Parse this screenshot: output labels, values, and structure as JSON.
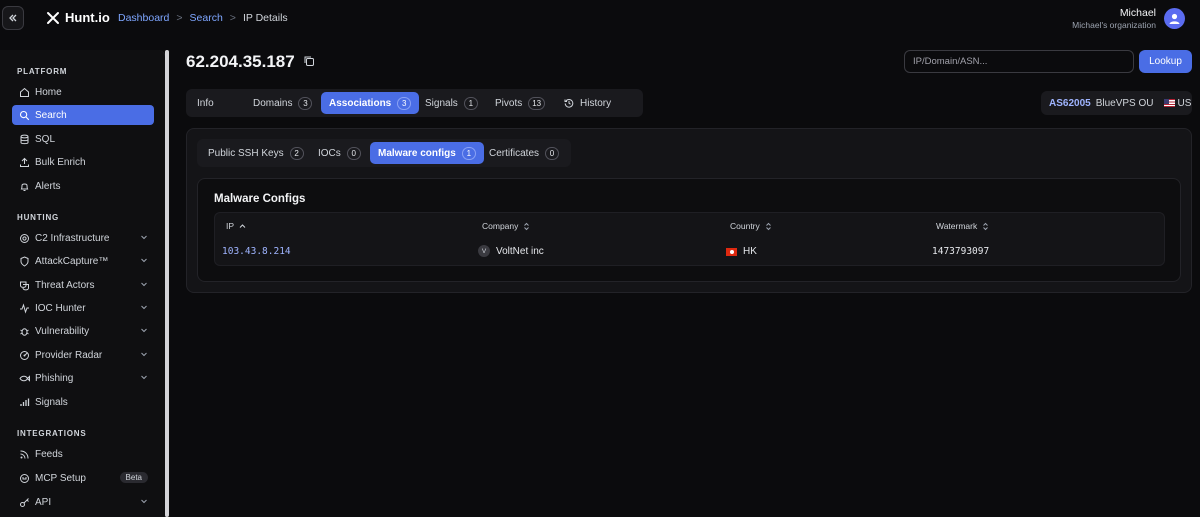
{
  "app": {
    "logo": "Hunt.io"
  },
  "breadcrumb": [
    "Dashboard",
    "Search",
    "IP Details"
  ],
  "breadcrumb_sep": ">",
  "user": {
    "name": "Michael",
    "org": "Michael's organization"
  },
  "sidebar": {
    "platform_title": "PLATFORM",
    "platform": [
      {
        "label": "Home",
        "icon": "home-icon"
      },
      {
        "label": "Search",
        "icon": "search-icon",
        "active": true
      },
      {
        "label": "SQL",
        "icon": "database-icon"
      },
      {
        "label": "Bulk Enrich",
        "icon": "upload-icon"
      },
      {
        "label": "Alerts",
        "icon": "bell-icon"
      }
    ],
    "hunting_title": "HUNTING",
    "hunting": [
      {
        "label": "C2 Infrastructure",
        "icon": "target-icon"
      },
      {
        "label": "AttackCapture™",
        "icon": "shield-icon"
      },
      {
        "label": "Threat Actors",
        "icon": "masks-icon"
      },
      {
        "label": "IOC Hunter",
        "icon": "activity-icon"
      },
      {
        "label": "Vulnerability",
        "icon": "bug-icon"
      },
      {
        "label": "Provider Radar",
        "icon": "radar-icon"
      },
      {
        "label": "Phishing",
        "icon": "fish-icon"
      },
      {
        "label": "Signals",
        "icon": "signal-icon"
      }
    ],
    "integrations_title": "INTEGRATIONS",
    "integrations": [
      {
        "label": "Feeds",
        "icon": "rss-icon"
      },
      {
        "label": "MCP Setup",
        "icon": "plug-icon",
        "badge": "Beta"
      },
      {
        "label": "API",
        "icon": "key-icon"
      }
    ]
  },
  "ip": "62.204.35.187",
  "lookup": {
    "placeholder": "IP/Domain/ASN...",
    "button": "Lookup"
  },
  "tabs": [
    {
      "label": "Info"
    },
    {
      "label": "Domains",
      "count": "3"
    },
    {
      "label": "Associations",
      "count": "3",
      "active": true
    },
    {
      "label": "Signals",
      "count": "1"
    },
    {
      "label": "Pivots",
      "count": "13"
    },
    {
      "label": "History"
    }
  ],
  "asn": {
    "number": "AS62005",
    "org": "BlueVPS OU",
    "country": "US"
  },
  "subtabs": [
    {
      "label": "Public SSH Keys",
      "count": "2"
    },
    {
      "label": "IOCs",
      "count": "0"
    },
    {
      "label": "Malware configs",
      "count": "1",
      "active": true
    },
    {
      "label": "Certificates",
      "count": "0"
    }
  ],
  "malware": {
    "title": "Malware Configs",
    "columns": [
      "IP",
      "Company",
      "Country",
      "Watermark"
    ],
    "rows": [
      {
        "ip": "103.43.8.214",
        "company_initial": "V",
        "company": "VoltNet inc",
        "country": "HK",
        "watermark": "1473793097"
      }
    ]
  },
  "colors": {
    "accent": "#4a6de5",
    "link": "#7ea6ff",
    "background": "#0b0b0d"
  }
}
